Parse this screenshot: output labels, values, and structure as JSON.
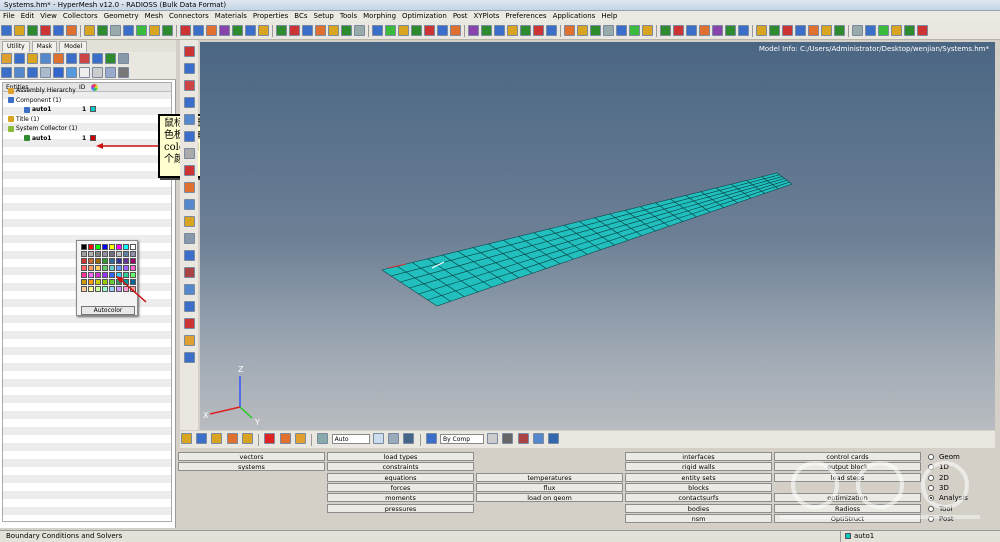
{
  "window": {
    "title": "Systems.hm* - HyperMesh v12.0 - RADIOSS (Bulk Data Format)"
  },
  "menu": [
    "File",
    "Edit",
    "View",
    "Collectors",
    "Geometry",
    "Mesh",
    "Connectors",
    "Materials",
    "Properties",
    "BCs",
    "Setup",
    "Tools",
    "Morphing",
    "Optimization",
    "Post",
    "XYPlots",
    "Preferences",
    "Applications",
    "Help"
  ],
  "tabs": [
    "Utility",
    "Mask",
    "Model"
  ],
  "browser": {
    "headers": {
      "entities": "Entities",
      "id": "ID"
    },
    "rows": [
      {
        "label": "Assembly Hierarchy",
        "id": "",
        "indent": 0,
        "bold": false
      },
      {
        "label": "Component (1)",
        "id": "",
        "indent": 0,
        "bold": false
      },
      {
        "label": "auto1",
        "id": "1",
        "indent": 2,
        "bold": true,
        "swatch": "#00c8c8"
      },
      {
        "label": "Title (1)",
        "id": "",
        "indent": 0,
        "bold": false
      },
      {
        "label": "System Collector (1)",
        "id": "",
        "indent": 0,
        "bold": false
      },
      {
        "label": "auto1",
        "id": "1",
        "indent": 2,
        "bold": true,
        "swatch": "#cc0000"
      }
    ]
  },
  "palette": {
    "colors": [
      "#000000",
      "#ff0000",
      "#00ff00",
      "#0000ff",
      "#ffff00",
      "#ff00ff",
      "#00ffff",
      "#ffffff",
      "#a0a0a0",
      "#b0b0b0",
      "#808080",
      "#9090a0",
      "#707080",
      "#c0c0c0",
      "#6080a0",
      "#9090b0",
      "#cc3333",
      "#cc6633",
      "#996600",
      "#339933",
      "#336699",
      "#333399",
      "#663399",
      "#990066",
      "#ff6666",
      "#ff9966",
      "#ffcc66",
      "#66cc66",
      "#66cccc",
      "#6699ff",
      "#9966ff",
      "#ff66cc",
      "#ff3399",
      "#ff66ff",
      "#cc33cc",
      "#9933ff",
      "#3366ff",
      "#33ccff",
      "#33cc99",
      "#66ff66",
      "#cc9900",
      "#ff9900",
      "#cccc00",
      "#99cc00",
      "#66cc33",
      "#339966",
      "#009999",
      "#006699",
      "#ffcc99",
      "#ffff99",
      "#ccff99",
      "#99ffcc",
      "#99ccff",
      "#cc99ff",
      "#ff99cc",
      "#ff9999"
    ],
    "autocolor_label": "Autocolor"
  },
  "callout": {
    "text": "鼠标右击弹出调色板，单击Autocolor自从生成一个颜色。"
  },
  "viewport": {
    "model_info": "Model Info: C:/Users/Administrator/Desktop/wenjian/Systems.hm*",
    "mesh_color": "#22bfbf"
  },
  "axes": {
    "x": "X",
    "y": "Y",
    "z": "Z"
  },
  "bottom_toolbar": {
    "vis_mode": "Auto",
    "color_mode": "By Comp"
  },
  "panels": {
    "col1": [
      "vectors",
      "systems"
    ],
    "col2": [
      "load types",
      "constraints",
      "equations",
      "forces",
      "moments",
      "pressures"
    ],
    "col3": [
      "temperatures",
      "flux",
      "load on geom"
    ],
    "col4": [
      "interfaces",
      "rigid walls",
      "entity sets",
      "blocks",
      "contactsurfs",
      "bodies",
      "nsm"
    ],
    "col5": [
      "control cards",
      "output block",
      "load steps",
      "",
      "optimization",
      "Radioss",
      "OptiStruct"
    ]
  },
  "radios": [
    {
      "label": "Geom",
      "on": false
    },
    {
      "label": "1D",
      "on": false
    },
    {
      "label": "2D",
      "on": false
    },
    {
      "label": "3D",
      "on": false
    },
    {
      "label": "Analysis",
      "on": true
    },
    {
      "label": "Tool",
      "on": false
    },
    {
      "label": "Post",
      "on": false
    }
  ],
  "status": {
    "text": "Boundary Conditions and Solvers",
    "component": "auto1"
  }
}
